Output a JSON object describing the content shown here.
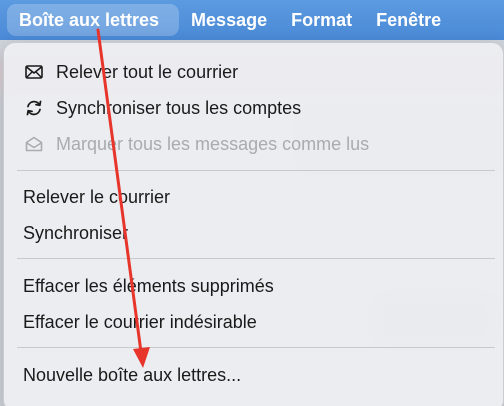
{
  "menubar": {
    "items": [
      {
        "label": "Boîte aux lettres"
      },
      {
        "label": "Message"
      },
      {
        "label": "Format"
      },
      {
        "label": "Fenêtre"
      }
    ]
  },
  "menu": {
    "items": [
      {
        "label": "Relever tout le courrier",
        "icon": "envelope-icon",
        "enabled": true
      },
      {
        "label": "Synchroniser tous les comptes",
        "icon": "sync-icon",
        "enabled": true
      },
      {
        "label": "Marquer tous les messages comme lus",
        "icon": "open-envelope-icon",
        "enabled": false
      },
      {
        "label": "Relever le courrier",
        "enabled": true
      },
      {
        "label": "Synchroniser",
        "enabled": true
      },
      {
        "label": "Effacer les éléments supprimés",
        "enabled": true
      },
      {
        "label": "Effacer le courrier indésirable",
        "enabled": true
      },
      {
        "label": "Nouvelle boîte aux lettres...",
        "enabled": true
      }
    ]
  },
  "colors": {
    "menubar": "#4a89d6",
    "arrow": "#e8352b",
    "disabled_text": "#a9abaf"
  }
}
